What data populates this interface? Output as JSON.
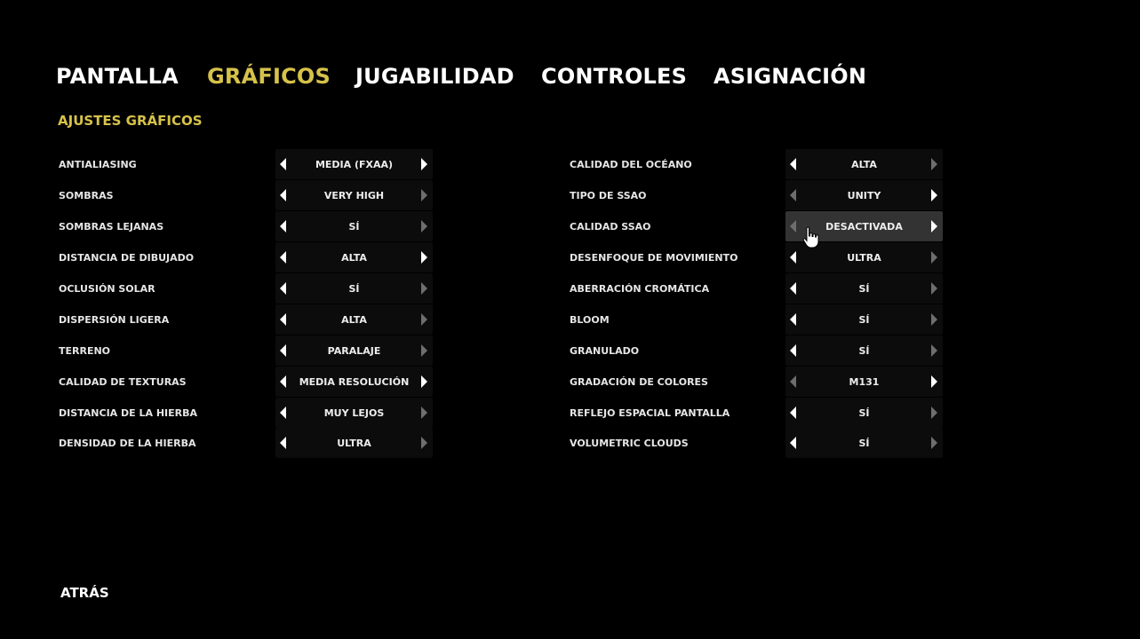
{
  "tabs": [
    {
      "label": "PANTALLA",
      "active": false
    },
    {
      "label": "GRÁFICOS",
      "active": true
    },
    {
      "label": "JUGABILIDAD",
      "active": false
    },
    {
      "label": "CONTROLES",
      "active": false
    },
    {
      "label": "ASIGNACIÓN",
      "active": false
    }
  ],
  "section_title": "AJUSTES GRÁFICOS",
  "accent_color": "#d6c24a",
  "left_settings": [
    {
      "label": "ANTIALIASING",
      "value": "MEDIA (FXAA)",
      "left_enabled": true,
      "right_enabled": true
    },
    {
      "label": "SOMBRAS",
      "value": "VERY HIGH",
      "left_enabled": true,
      "right_enabled": false
    },
    {
      "label": "SOMBRAS LEJANAS",
      "value": "SÍ",
      "left_enabled": true,
      "right_enabled": false
    },
    {
      "label": "DISTANCIA DE DIBUJADO",
      "value": "ALTA",
      "left_enabled": true,
      "right_enabled": true
    },
    {
      "label": "OCLUSIÓN SOLAR",
      "value": "SÍ",
      "left_enabled": true,
      "right_enabled": false
    },
    {
      "label": "DISPERSIÓN LIGERA",
      "value": "ALTA",
      "left_enabled": true,
      "right_enabled": false
    },
    {
      "label": "TERRENO",
      "value": "PARALAJE",
      "left_enabled": true,
      "right_enabled": false
    },
    {
      "label": "CALIDAD DE TEXTURAS",
      "value": "MEDIA RESOLUCIÓN",
      "left_enabled": true,
      "right_enabled": true
    },
    {
      "label": "DISTANCIA DE LA HIERBA",
      "value": "MUY LEJOS",
      "left_enabled": true,
      "right_enabled": false
    },
    {
      "label": "DENSIDAD DE LA HIERBA",
      "value": "ULTRA",
      "left_enabled": true,
      "right_enabled": false
    }
  ],
  "right_settings": [
    {
      "label": "CALIDAD DEL OCÉANO",
      "value": "ALTA",
      "left_enabled": true,
      "right_enabled": false
    },
    {
      "label": "TIPO DE SSAO",
      "value": "UNITY",
      "left_enabled": false,
      "right_enabled": true
    },
    {
      "label": "CALIDAD SSAO",
      "value": "DESACTIVADA",
      "left_enabled": false,
      "right_enabled": true,
      "hovered": true
    },
    {
      "label": "DESENFOQUE DE MOVIMIENTO",
      "value": "ULTRA",
      "left_enabled": true,
      "right_enabled": false
    },
    {
      "label": "ABERRACIÓN CROMÁTICA",
      "value": "SÍ",
      "left_enabled": true,
      "right_enabled": false
    },
    {
      "label": "BLOOM",
      "value": "SÍ",
      "left_enabled": true,
      "right_enabled": false
    },
    {
      "label": "GRANULADO",
      "value": "SÍ",
      "left_enabled": true,
      "right_enabled": false
    },
    {
      "label": "GRADACIÓN DE COLORES",
      "value": "M131",
      "left_enabled": false,
      "right_enabled": true
    },
    {
      "label": "REFLEJO ESPACIAL PANTALLA",
      "value": "SÍ",
      "left_enabled": true,
      "right_enabled": false
    },
    {
      "label": "VOLUMETRIC CLOUDS",
      "value": "SÍ",
      "left_enabled": true,
      "right_enabled": false
    }
  ],
  "back_label": "ATRÁS",
  "cursor_icon": "hand-pointer-icon"
}
